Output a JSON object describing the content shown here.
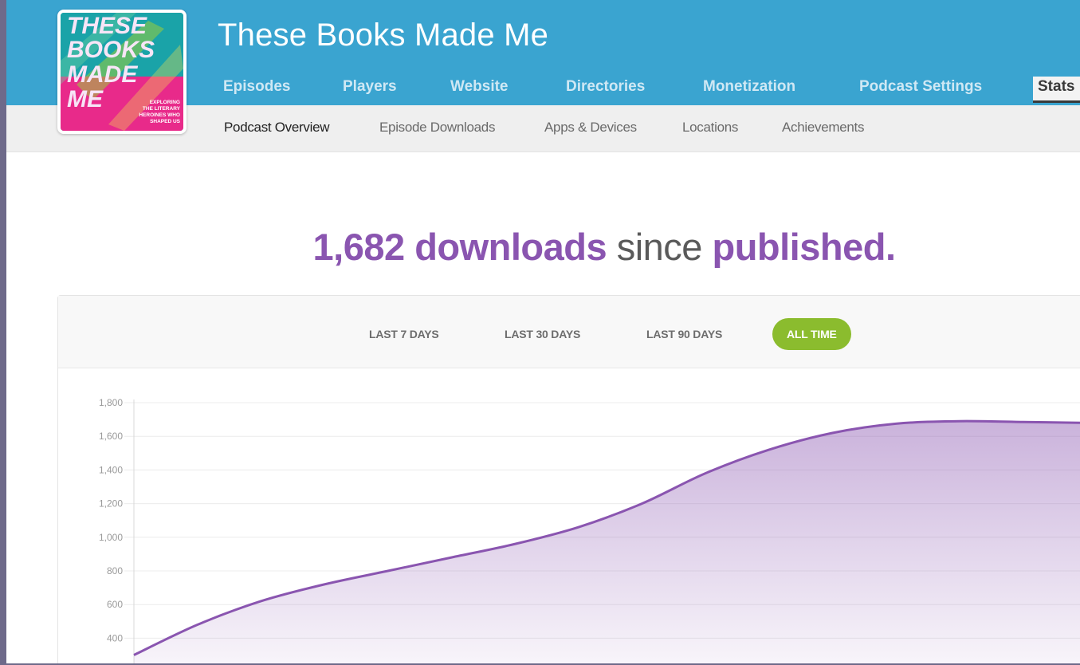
{
  "podcast": {
    "title": "These Books Made Me"
  },
  "cover": {
    "lines": [
      "THESE",
      "BOOKS",
      "MADE",
      "ME"
    ],
    "tagline": [
      "EXPLORING",
      "THE LITERARY",
      "HEROINES WHO",
      "SHAPED US"
    ]
  },
  "main_nav": [
    {
      "label": "Episodes",
      "active": false
    },
    {
      "label": "Players",
      "active": false
    },
    {
      "label": "Website",
      "active": false
    },
    {
      "label": "Directories",
      "active": false
    },
    {
      "label": "Monetization",
      "active": false
    },
    {
      "label": "Podcast Settings",
      "active": false
    },
    {
      "label": "Stats",
      "active": true
    }
  ],
  "sub_nav": [
    {
      "label": "Podcast Overview",
      "active": true
    },
    {
      "label": "Episode Downloads",
      "active": false
    },
    {
      "label": "Apps & Devices",
      "active": false
    },
    {
      "label": "Locations",
      "active": false
    },
    {
      "label": "Achievements",
      "active": false
    }
  ],
  "headline": {
    "count": "1,682",
    "word1": "downloads",
    "word2": "since",
    "word3": "published."
  },
  "ranges": [
    {
      "label": "LAST 7 DAYS",
      "active": false
    },
    {
      "label": "LAST 30 DAYS",
      "active": false
    },
    {
      "label": "LAST 90 DAYS",
      "active": false
    },
    {
      "label": "ALL TIME",
      "active": true
    }
  ],
  "colors": {
    "header": "#3aa4d0",
    "accent": "#8a55b0",
    "active_range": "#8bbc2e"
  },
  "chart_data": {
    "type": "area",
    "title": "",
    "xlabel": "",
    "ylabel": "",
    "ylim": [
      400,
      1800
    ],
    "y_ticks": [
      "1,800",
      "1,600",
      "1,400",
      "1,200",
      "1,000",
      "800",
      "600",
      "400"
    ],
    "grid": true,
    "series": [
      {
        "values": [
          300,
          480,
          620,
          720,
          800,
          880,
          960,
          1060,
          1200,
          1380,
          1520,
          1620,
          1675,
          1690,
          1685,
          1680
        ]
      }
    ]
  }
}
